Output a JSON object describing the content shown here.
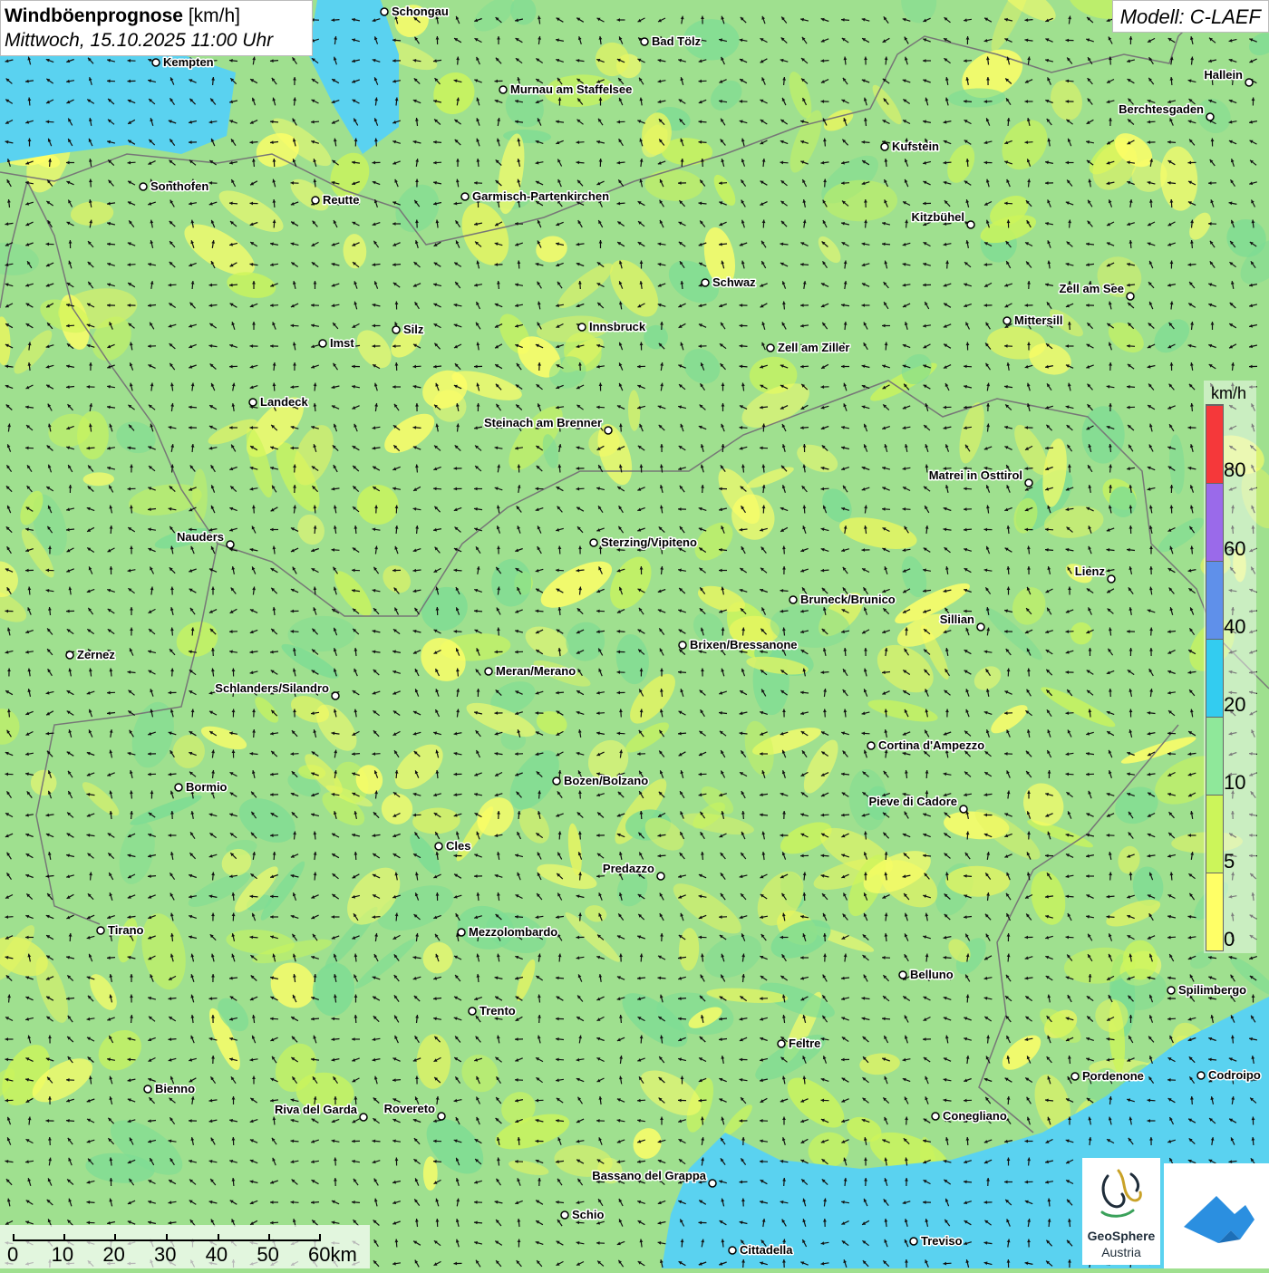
{
  "title": {
    "main": "Windböenprognose",
    "unit": "[km/h]",
    "datetime": "Mittwoch, 15.10.2025 11:00 Uhr"
  },
  "model": "Modell: C-LAEF",
  "legend": {
    "unit": "km/h",
    "labels": [
      "0",
      "5",
      "10",
      "20",
      "40",
      "60",
      "80"
    ],
    "colors": [
      "#ffff66",
      "#ccf55a",
      "#8fe89a",
      "#33ccf0",
      "#5f90ea",
      "#9a6aea",
      "#f5383a"
    ]
  },
  "scale": {
    "labels": [
      "0",
      "10",
      "20",
      "30",
      "40",
      "50",
      "60km"
    ]
  },
  "logo": {
    "name": "GeoSphere",
    "country": "Austria"
  },
  "cities": [
    {
      "name": "Schongau"
    },
    {
      "name": "Bad Tölz"
    },
    {
      "name": "Kempten"
    },
    {
      "name": "Murnau am Staffelsee"
    },
    {
      "name": "Hallein"
    },
    {
      "name": "Berchtesgaden"
    },
    {
      "name": "Kufstein"
    },
    {
      "name": "Sonthofen"
    },
    {
      "name": "Reutte"
    },
    {
      "name": "Garmisch-Partenkirchen"
    },
    {
      "name": "Kitzbühel"
    },
    {
      "name": "Schwaz"
    },
    {
      "name": "Zell am See"
    },
    {
      "name": "Innsbruck"
    },
    {
      "name": "Mittersill"
    },
    {
      "name": "Silz"
    },
    {
      "name": "Imst"
    },
    {
      "name": "Zell am Ziller"
    },
    {
      "name": "Landeck"
    },
    {
      "name": "Steinach am Brenner"
    },
    {
      "name": "Matrei in Osttirol"
    },
    {
      "name": "Nauders"
    },
    {
      "name": "Sterzing/Vipiteno"
    },
    {
      "name": "Lienz"
    },
    {
      "name": "Bruneck/Brunico"
    },
    {
      "name": "Sillian"
    },
    {
      "name": "Brixen/Bressanone"
    },
    {
      "name": "Zernez"
    },
    {
      "name": "Meran/Merano"
    },
    {
      "name": "Schlanders/Silandro"
    },
    {
      "name": "Cortina d'Ampezzo"
    },
    {
      "name": "Bozen/Bolzano"
    },
    {
      "name": "Bormio"
    },
    {
      "name": "Pieve di Cadore"
    },
    {
      "name": "Cles"
    },
    {
      "name": "Predazzo"
    },
    {
      "name": "Tirano"
    },
    {
      "name": "Mezzolombardo"
    },
    {
      "name": "Belluno"
    },
    {
      "name": "Spilimbergo"
    },
    {
      "name": "Trento"
    },
    {
      "name": "Feltre"
    },
    {
      "name": "Bienno"
    },
    {
      "name": "Pordenone"
    },
    {
      "name": "Codroipo"
    },
    {
      "name": "Riva del Garda"
    },
    {
      "name": "Rovereto"
    },
    {
      "name": "Conegliano"
    },
    {
      "name": "Bassano del Grappa"
    },
    {
      "name": "Schio"
    },
    {
      "name": "Treviso"
    },
    {
      "name": "Cittadella"
    }
  ]
}
